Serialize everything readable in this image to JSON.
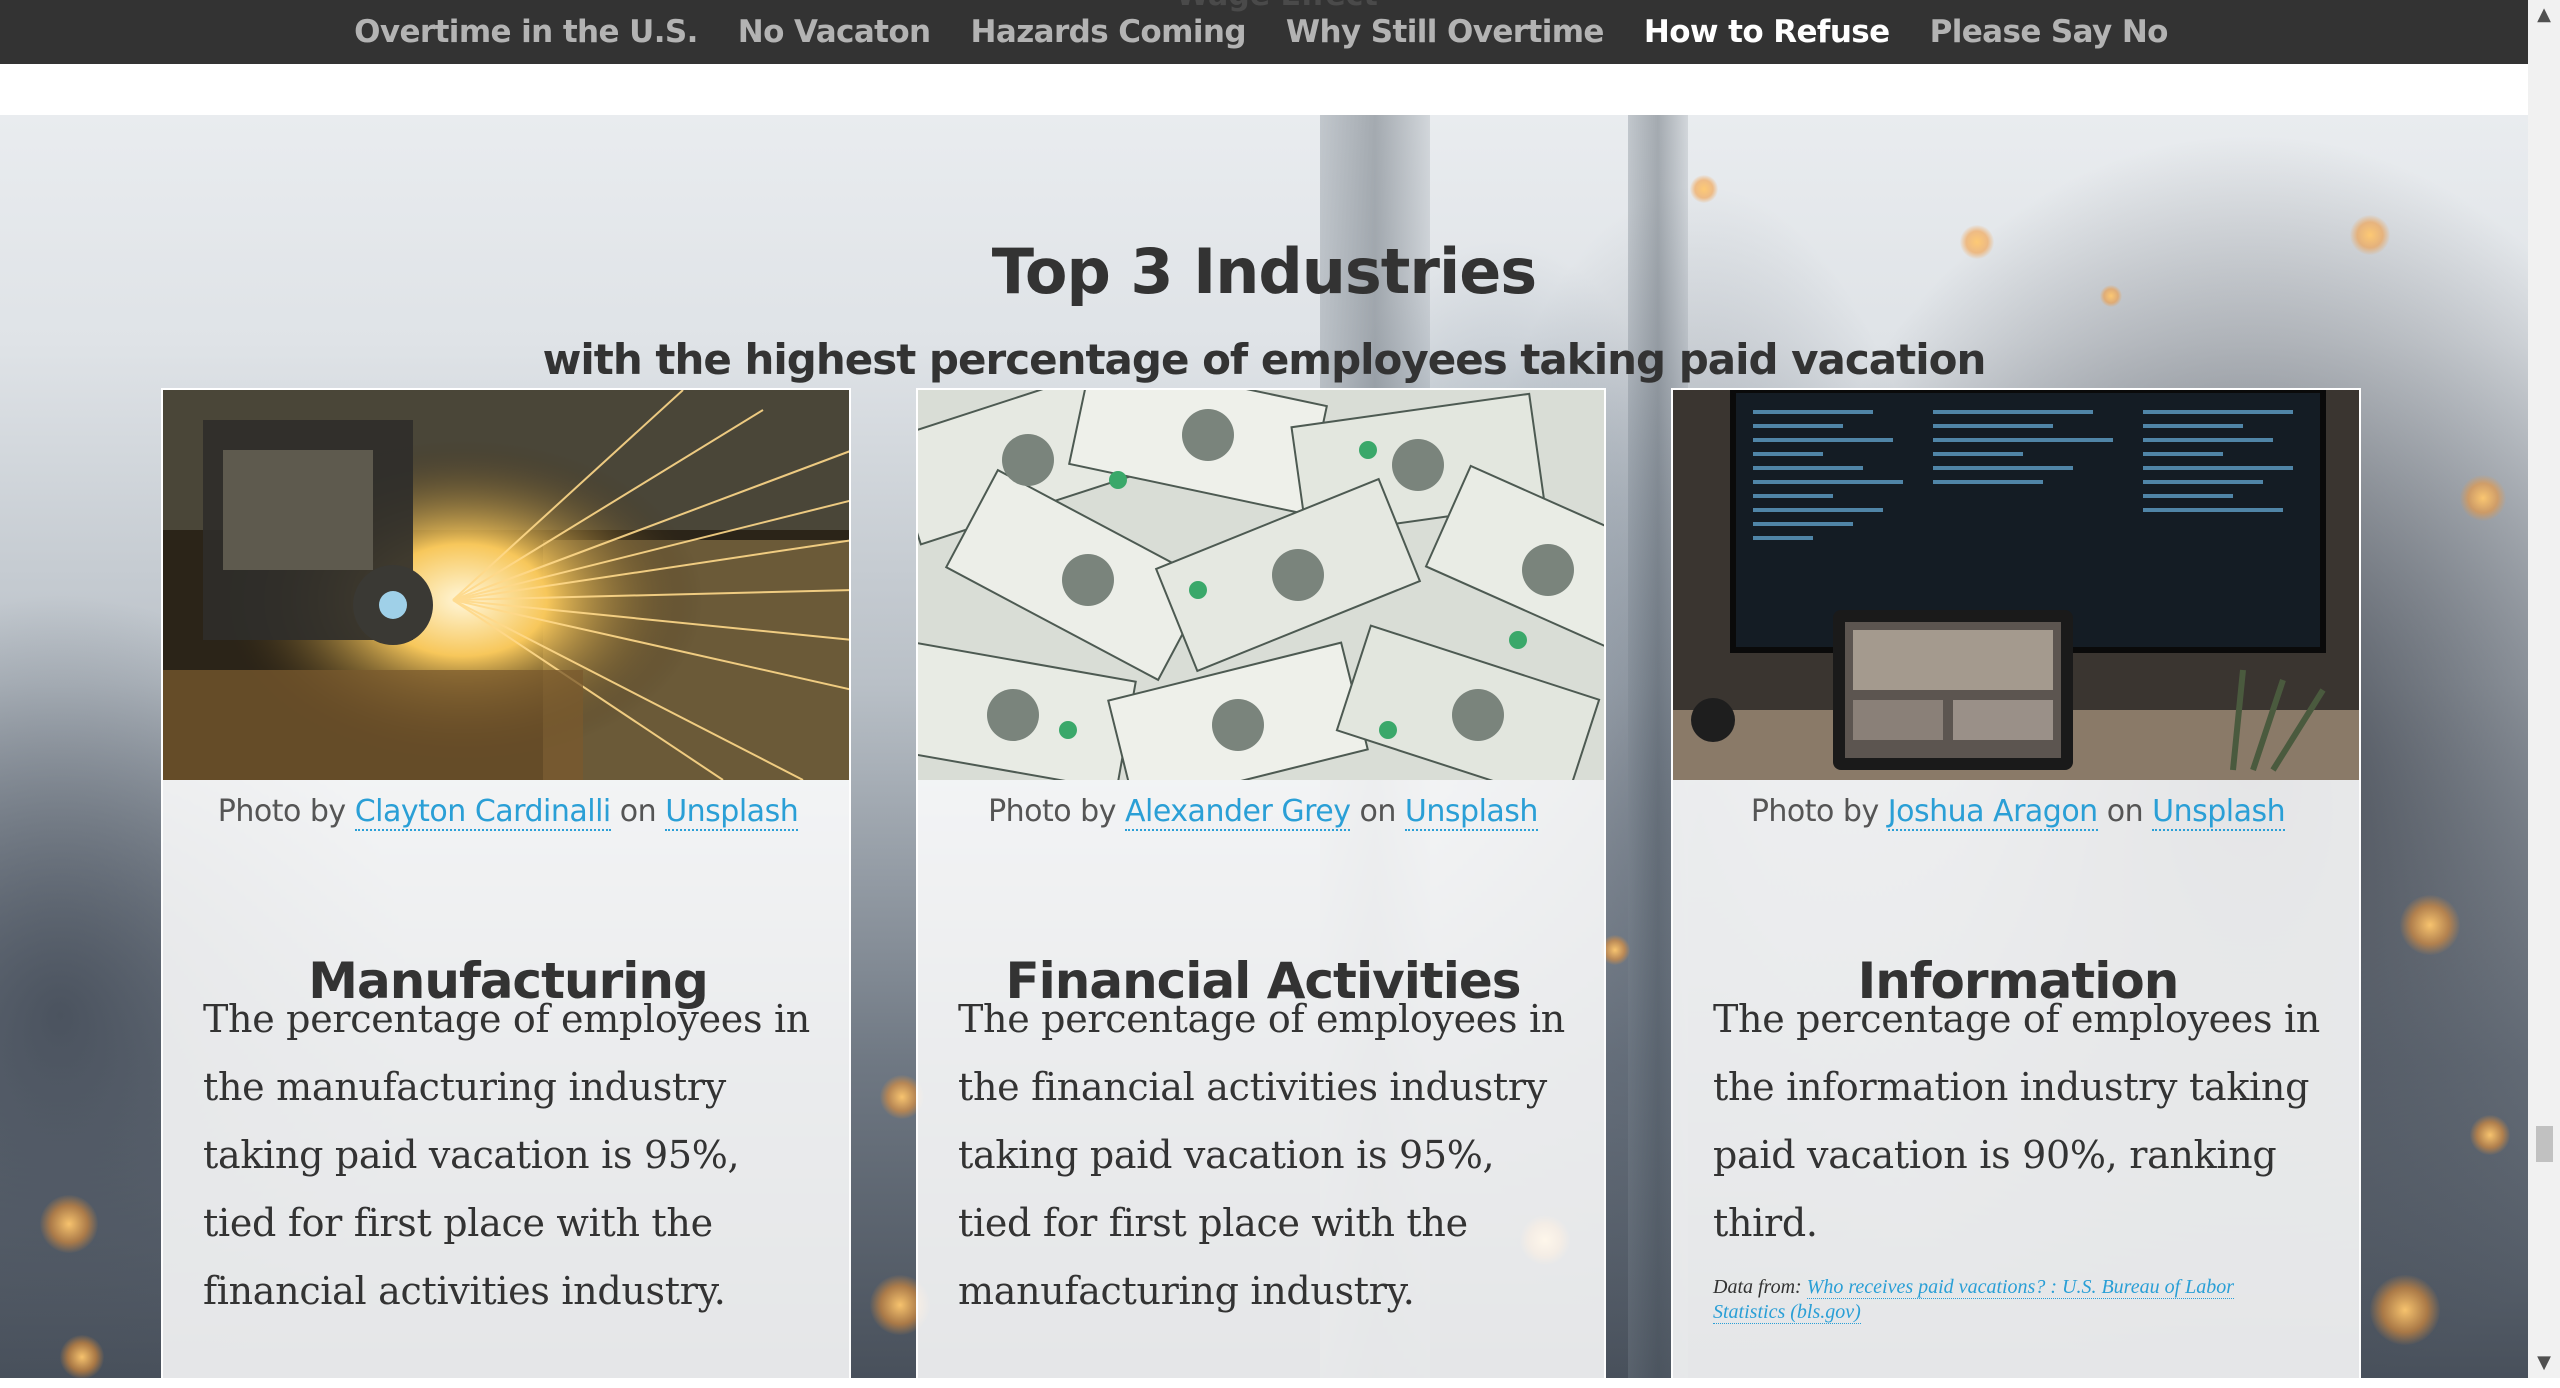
{
  "nav": {
    "ghost_text": "Wage Effect",
    "links": [
      {
        "label": "Overtime in the U.S.",
        "active": false
      },
      {
        "label": "No Vacaton",
        "active": false
      },
      {
        "label": "Hazards Coming",
        "active": false
      },
      {
        "label": "Why Still Overtime",
        "active": false
      },
      {
        "label": "How to Refuse",
        "active": true
      },
      {
        "label": "Please Say No",
        "active": false
      }
    ]
  },
  "section": {
    "title": "Top 3 Industries",
    "subtitle": "with the highest percentage of employees taking paid vacation"
  },
  "cards": [
    {
      "credit_prefix": "Photo by ",
      "photographer": "Clayton Cardinalli",
      "credit_mid": " on ",
      "site": "Unsplash",
      "photo_icon": "metal-grinding-sparks-photo",
      "title": "Manufacturing",
      "body": "The percentage of employees in the manufacturing industry taking paid vacation is 95%, tied for first place with the financial activities industry."
    },
    {
      "credit_prefix": "Photo by ",
      "photographer": "Alexander Grey",
      "credit_mid": " on ",
      "site": "Unsplash",
      "photo_icon": "dollar-bills-photo",
      "title": "Financial Activities",
      "body": "The percentage of employees in the financial activities industry taking paid vacation is 95%, tied for first place with the manufacturing industry."
    },
    {
      "credit_prefix": "Photo by ",
      "photographer": "Joshua Aragon",
      "credit_mid": " on ",
      "site": "Unsplash",
      "photo_icon": "computer-monitor-code-photo",
      "title": "Information",
      "body": "The percentage of employees in the information industry taking paid vacation is 90%, ranking third.",
      "source_label": "Data from: ",
      "source_link": "Who receives paid vacations? : U.S. Bureau of Labor Statistics (bls.gov)"
    }
  ],
  "colors": {
    "nav_bg": "#333333",
    "nav_link": "#b3b3b3",
    "nav_active": "#ffffff",
    "link": "#2a9fd6",
    "heading": "#333333"
  },
  "scrollbar": {
    "position_fraction": 0.82
  }
}
